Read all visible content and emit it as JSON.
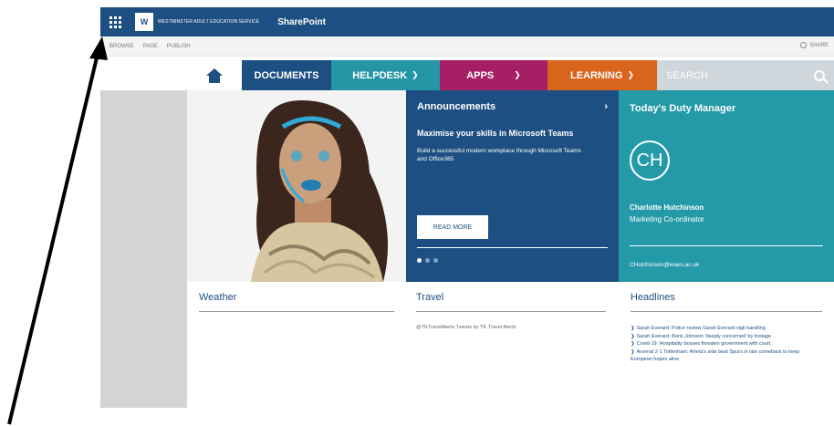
{
  "suite_bar": {
    "logo_mark": "W",
    "logo_text": "WESTMINSTER ADULT EDUCATION SERVICE",
    "app_title": "SharePoint"
  },
  "command_bar": {
    "items": [
      "BROWSE",
      "PAGE",
      "PUBLISH"
    ],
    "share_label": "SHARE"
  },
  "nav": {
    "documents": "DOCUMENTS",
    "helpdesk": "HELPDESK",
    "apps": "APPS",
    "learning": "LEARNING",
    "search_placeholder": "SEARCH"
  },
  "announcements": {
    "heading": "Announcements",
    "next_glyph": "›",
    "title": "Maximise your skills in Microsoft Teams",
    "body": "Build a successful modern workplace through Microsoft Teams and Office365",
    "button": "READ MORE",
    "slide_count": 3,
    "active_slide": 1
  },
  "duty_manager": {
    "heading": "Today's Duty Manager",
    "initials": "CH",
    "name": "Charlotte Hutchinson",
    "role": "Marketing Co-ordinator",
    "email": "CHutchinson@waes.ac.uk"
  },
  "weather": {
    "title": "Weather"
  },
  "travel": {
    "title": "Travel",
    "text": "@TfLTravelAlerts Tweets by TfL Travel Alerts"
  },
  "headlines": {
    "title": "Headlines",
    "items": [
      "Sarah Everard: Police review Sarah Everard vigil handling",
      "Sarah Everard: Boris Johnson 'deeply concerned' by footage",
      "Covid-19: Hospitality bosses threaten government with court",
      "Arsenal 2-1 Tottenham: Arteta's side beat Spurs in late comeback to keep European hopes alive"
    ]
  },
  "colors": {
    "brand_blue": "#1e4f82",
    "teal": "#249aa8",
    "magenta": "#a61e66",
    "orange": "#d9641c"
  }
}
